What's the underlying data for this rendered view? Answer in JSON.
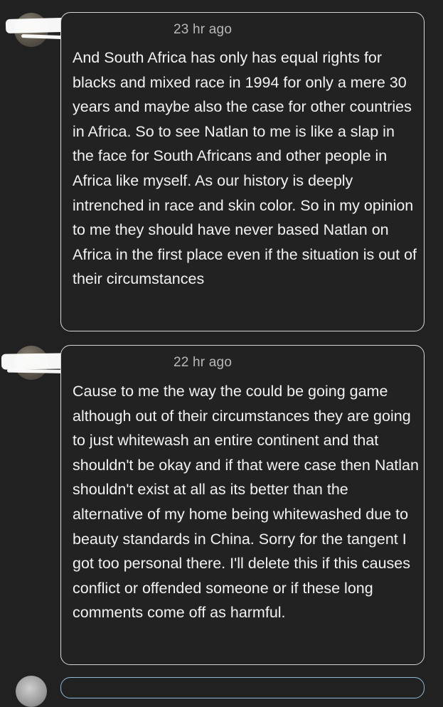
{
  "comments": [
    {
      "time": "23 hr ago",
      "body": "And South Africa has only has equal rights for blacks and mixed race in 1994 for only a mere 30 years and maybe also the case for other countries in Africa. So to see Natlan to me is like a slap in the face for South Africans and other people in Africa like myself. As our history is deeply intrenched in race and skin color. So in my opinion to me they should have never based Natlan on Africa in the first place even if the situation is out of their circumstances"
    },
    {
      "time": "22 hr ago",
      "body": "Cause to me the way the could be going game although out of their circumstances they are going to just whitewash an entire continent and that shouldn't be okay and if that were case  then Natlan shouldn't exist at all as its better than the alternative of my home being whitewashed due to beauty standards in China. Sorry for the tangent I got too personal there. I'll delete this if this causes conflict or offended someone or if these long comments come off as harmful."
    }
  ],
  "colors": {
    "background": "#212121",
    "bubble_border": "#d6d6d6",
    "text": "#f2f2f2",
    "timestamp": "#b8b8b8",
    "next_bubble_border": "#8fb9d6"
  }
}
